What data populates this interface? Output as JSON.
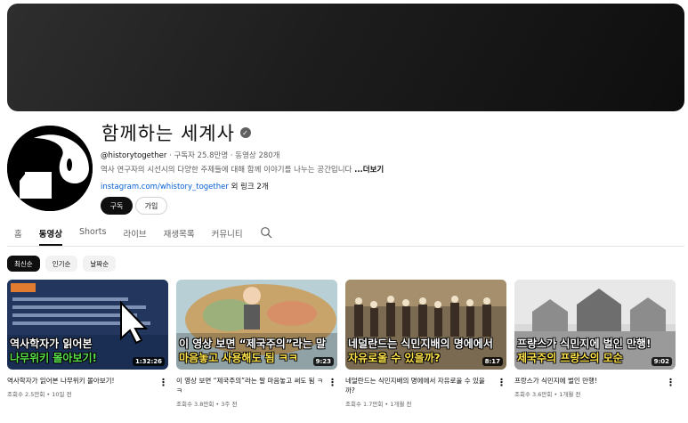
{
  "channel": {
    "name": "함께하는 세계사",
    "verified_icon": "verified-check-icon",
    "handle": "@historytogether",
    "subscribers": "구독자 25.8만명",
    "video_count": "동영상 280개",
    "separator": "‧",
    "description": "역사 연구자의 시선시의 다양한 주제들에 대해 함께 이야기를 나누는 공간입니다",
    "more_label": "...더보기",
    "link": "instagram.com/whistory_together",
    "link_suffix": "외 링크 2개",
    "subscribe_label": "구독",
    "join_label": "가입"
  },
  "tabs": [
    {
      "label": "홈",
      "active": false
    },
    {
      "label": "동영상",
      "active": true
    },
    {
      "label": "Shorts",
      "active": false
    },
    {
      "label": "라이브",
      "active": false
    },
    {
      "label": "재생목록",
      "active": false
    },
    {
      "label": "커뮤니티",
      "active": false
    }
  ],
  "search_icon": "search-icon",
  "chips": [
    {
      "label": "최신순",
      "active": true
    },
    {
      "label": "인기순",
      "active": false
    },
    {
      "label": "날짜순",
      "active": false
    }
  ],
  "videos": [
    {
      "caption_top": "역사학자가 읽어본",
      "caption_bottom": "나무위키 몰아보기!",
      "duration": "1:32:26",
      "title": "역사학자가 읽어본 나무위키 몰아보기!",
      "meta": "조회수 2.5만회 • 10일 전"
    },
    {
      "caption_top": "이 영상 보면 “제국주의”라는 말",
      "caption_bottom": "마음놓고 사용해도 됨 ㅋㅋ",
      "duration": "9:23",
      "title": "이 영상 보면 “제국주의”라는 말 마음놓고 써도 됨 ㅋㅋ",
      "meta": "조회수 3.8만회 • 3주 전"
    },
    {
      "caption_top": "네덜란드는 식민지배의 명에에서",
      "caption_bottom": "자유로울 수 있을까?",
      "duration": "8:17",
      "title": "네덜란드는 식민지배의 명에에서 자유로울 수 있을까?",
      "meta": "조회수 1.7만회 • 1개월 전"
    },
    {
      "caption_top": "프랑스가 식민지에 벌인 만행!",
      "caption_bottom": "제국주의 프랑스의 모순",
      "duration": "9:02",
      "title": "프랑스가 식민지에 벌인 만행!",
      "meta": "조회수 3.6만회 • 1개월 전"
    }
  ],
  "menu_icon": "more-vert-icon"
}
